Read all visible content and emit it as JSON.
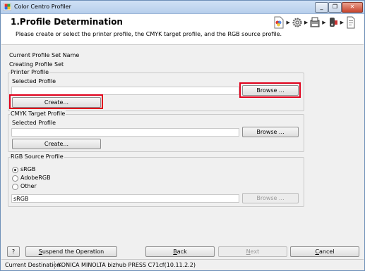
{
  "window": {
    "title": "Color Centro Profiler",
    "minimize": "_",
    "restore": "❐",
    "close": "✕"
  },
  "header": {
    "title": "1.Profile Determination",
    "description": "Please create or select the printer profile, the CMYK target profile, and the RGB source profile.",
    "steps": [
      "profile-step-icon",
      "settings-step-icon",
      "printer-step-icon",
      "measure-step-icon",
      "document-step-icon"
    ]
  },
  "profile_set": {
    "name_label": "Current Profile Set Name",
    "name_value": "Creating Profile Set"
  },
  "printer_profile": {
    "legend": "Printer Profile",
    "selected_label": "Selected Profile",
    "selected_value": "",
    "browse": "Browse ...",
    "create": "Create..."
  },
  "cmyk_profile": {
    "legend": "CMYK Target Profile",
    "selected_label": "Selected Profile",
    "selected_value": "",
    "browse": "Browse ...",
    "create": "Create..."
  },
  "rgb_profile": {
    "legend": "RGB Source Profile",
    "options": [
      "sRGB",
      "AdobeRGB",
      "Other"
    ],
    "selected": "sRGB",
    "field_value": "sRGB",
    "browse": "Browse ..."
  },
  "footer": {
    "help": "?",
    "suspend": {
      "pre": "",
      "key": "S",
      "post": "uspend the Operation"
    },
    "back": {
      "key": "B",
      "post": "ack"
    },
    "next": {
      "key": "N",
      "post": "ext"
    },
    "cancel": {
      "key": "C",
      "post": "ancel"
    }
  },
  "status": {
    "label": "Current Destination",
    "value": "KONICA MINOLTA bizhub PRESS C71cf(10.11.2.2)"
  },
  "colors": {
    "highlight": "#e0001b",
    "titlebar": "#c4d8f0"
  }
}
